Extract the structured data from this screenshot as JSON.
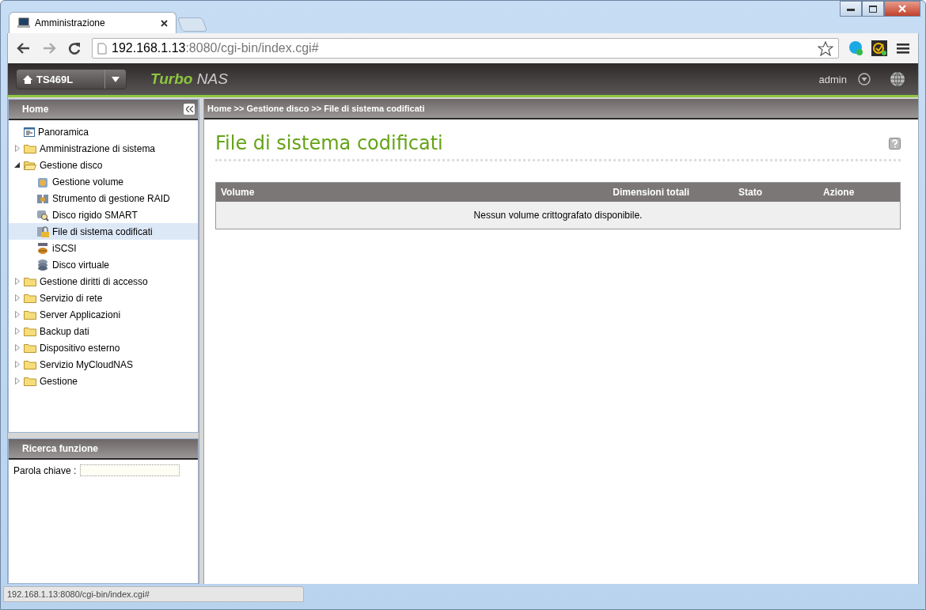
{
  "browser": {
    "tab": {
      "title": "Amministrazione"
    },
    "address": {
      "host": "192.168.1.13",
      "rest": ":8080/cgi-bin/index.cgi#"
    }
  },
  "nas_header": {
    "device": "TS469L",
    "brand_bold": "Turbo",
    "brand": "NAS",
    "user": "admin"
  },
  "sidebar": {
    "title": "Home",
    "tree": [
      {
        "label": "Panoramica",
        "kind": "page",
        "selected": false
      },
      {
        "label": "Amministrazione di sistema",
        "kind": "folder",
        "expanded": false,
        "selected": false
      },
      {
        "label": "Gestione disco",
        "kind": "folder",
        "expanded": true,
        "selected": false,
        "children": [
          {
            "label": "Gestione volume",
            "kind": "volume",
            "selected": false
          },
          {
            "label": "Strumento di gestione RAID",
            "kind": "raid",
            "selected": false
          },
          {
            "label": "Disco rigido SMART",
            "kind": "smart",
            "selected": false
          },
          {
            "label": "File di sistema codificati",
            "kind": "lock",
            "selected": true
          },
          {
            "label": "iSCSI",
            "kind": "iscsi",
            "selected": false
          },
          {
            "label": "Disco virtuale",
            "kind": "virtual",
            "selected": false
          }
        ]
      },
      {
        "label": "Gestione diritti di accesso",
        "kind": "folder",
        "expanded": false,
        "selected": false
      },
      {
        "label": "Servizio di rete",
        "kind": "folder",
        "expanded": false,
        "selected": false
      },
      {
        "label": "Server Applicazioni",
        "kind": "folder",
        "expanded": false,
        "selected": false
      },
      {
        "label": "Backup dati",
        "kind": "folder",
        "expanded": false,
        "selected": false
      },
      {
        "label": "Dispositivo esterno",
        "kind": "folder",
        "expanded": false,
        "selected": false
      },
      {
        "label": "Servizio MyCloudNAS",
        "kind": "folder",
        "expanded": false,
        "selected": false
      },
      {
        "label": "Gestione",
        "kind": "folder",
        "expanded": false,
        "selected": false
      }
    ]
  },
  "search": {
    "title": "Ricerca funzione",
    "label": "Parola chiave :"
  },
  "main": {
    "breadcrumb": "Home >> Gestione disco >> File di sistema codificati",
    "title": "File di sistema codificati",
    "table": {
      "columns": [
        "Volume",
        "Dimensioni totali",
        "Stato",
        "Azione"
      ],
      "empty_message": "Nessun volume crittografato disponibile."
    }
  },
  "status_bar": {
    "url": "192.168.1.13:8080/cgi-bin/index.cgi#"
  }
}
